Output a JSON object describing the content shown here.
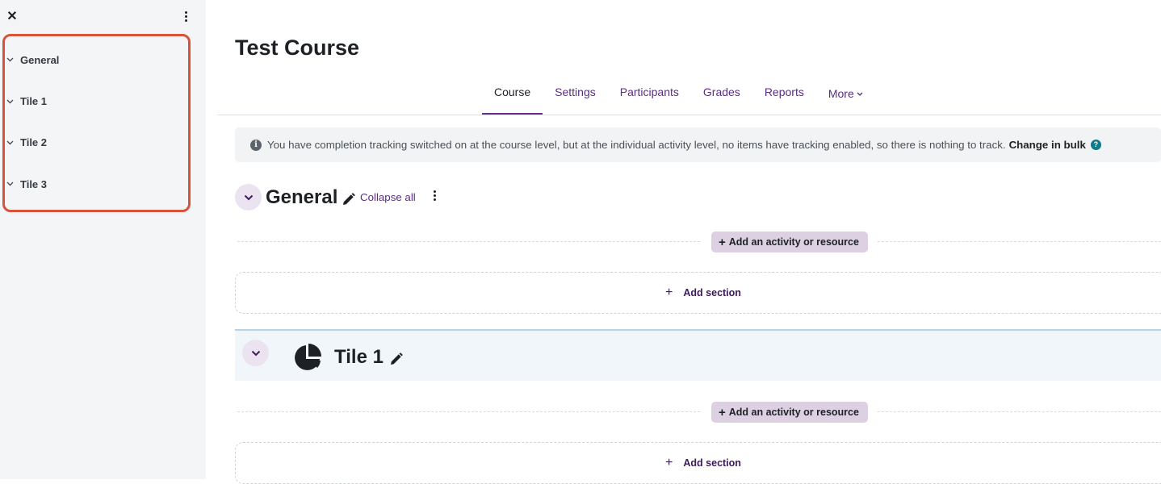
{
  "drawer": {
    "close_glyph": "✕",
    "index": [
      {
        "label": "General"
      },
      {
        "label": "Tile 1"
      },
      {
        "label": "Tile 2"
      },
      {
        "label": "Tile 3"
      }
    ],
    "highlight_color": "#d9533b"
  },
  "course": {
    "title": "Test Course"
  },
  "secondary_nav": {
    "tabs": [
      {
        "label": "Course",
        "active": true
      },
      {
        "label": "Settings"
      },
      {
        "label": "Participants"
      },
      {
        "label": "Grades"
      },
      {
        "label": "Reports"
      },
      {
        "label": "More"
      }
    ]
  },
  "alert": {
    "text": "You have completion tracking switched on at the course level, but at the individual activity level, no items have tracking enabled, so there is nothing to track.",
    "link": "Change in bulk",
    "help_glyph": "?",
    "info_glyph": "i"
  },
  "sections": {
    "general": {
      "title": "General",
      "collapse_all": "Collapse all",
      "add_activity": "Add an activity or resource",
      "add_section": "Add section"
    },
    "tile1": {
      "title": "Tile 1",
      "icon": "pie-chart-icon",
      "add_activity": "Add an activity or resource",
      "add_section": "Add section"
    }
  },
  "colors": {
    "accent": "#6b2d8b",
    "link": "#5a2d7e",
    "help": "#0f7a8a"
  }
}
